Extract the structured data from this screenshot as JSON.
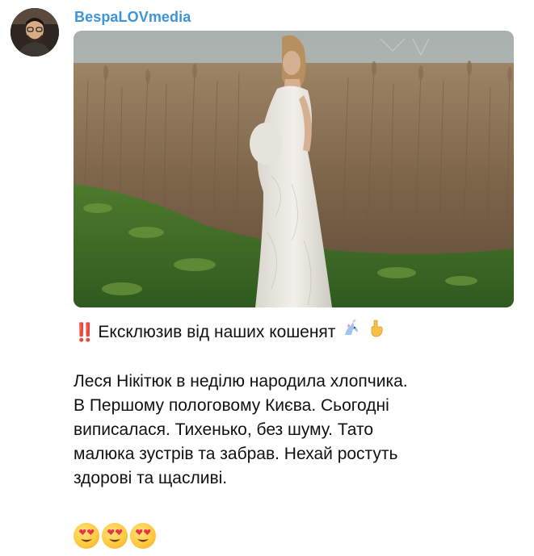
{
  "channel": {
    "name": "BespaLOVmedia"
  },
  "post": {
    "photo_alt": "pregnant-woman-in-white-dress-in-reed-field",
    "headline_prefix": "‼️",
    "headline": "Ексклюзив від наших кошенят",
    "headline_emojis": [
      "unicorn-icon",
      "point-down-icon"
    ],
    "body_lines": [
      "Леся Нікітюк в неділю народила хлопчика.",
      "В Першому пологовому Києва. Сьогодні",
      "виписалася. Тихенько, без шуму. Тато",
      "малюка зустрів та забрав. Нехай ростуть",
      "здорові та щасливі."
    ],
    "reaction_emojis": [
      "heart-eyes-icon",
      "heart-eyes-icon",
      "heart-eyes-icon"
    ]
  },
  "colors": {
    "channel_name": "#3d95d9",
    "text": "#111111",
    "exclamation": "#e5322d"
  }
}
